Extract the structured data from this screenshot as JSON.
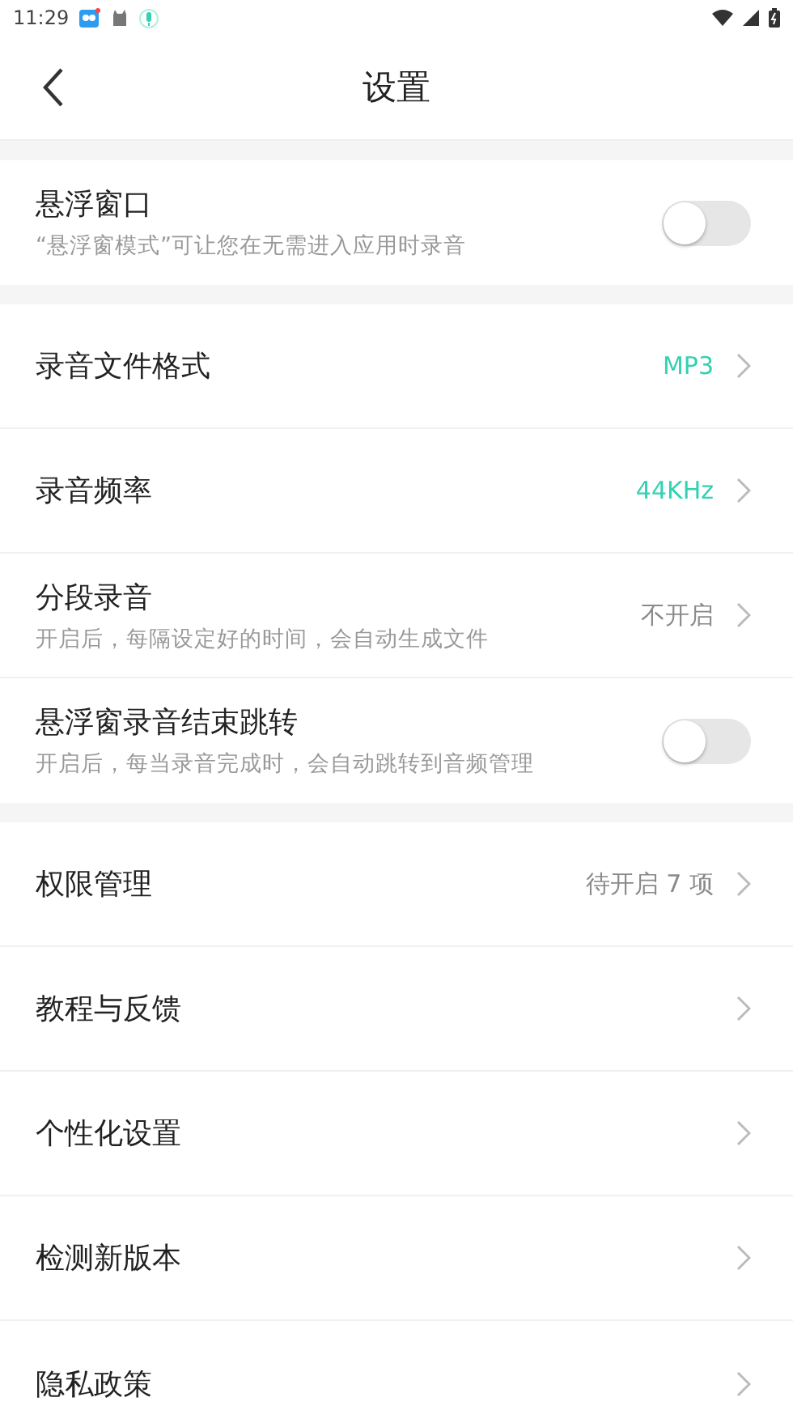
{
  "status_bar": {
    "time": "11:29"
  },
  "header": {
    "title": "设置"
  },
  "groups": [
    {
      "items": [
        {
          "kind": "toggle",
          "title": "悬浮窗口",
          "subtitle": "“悬浮窗模式”可让您在无需进入应用时录音",
          "on": false
        }
      ]
    },
    {
      "items": [
        {
          "kind": "link",
          "title": "录音文件格式",
          "value": "MP3",
          "color": "#33d1b3"
        },
        {
          "kind": "link",
          "title": "录音频率",
          "value": "44KHz",
          "color": "#33d1b3"
        },
        {
          "kind": "link",
          "title": "分段录音",
          "subtitle": "开启后，每隔设定好的时间，会自动生成文件",
          "value": "不开启",
          "color": "#8a8a8a"
        },
        {
          "kind": "toggle",
          "title": "悬浮窗录音结束跳转",
          "subtitle": "开启后，每当录音完成时，会自动跳转到音频管理",
          "on": false
        }
      ]
    },
    {
      "items": [
        {
          "kind": "link",
          "title": "权限管理",
          "value": "待开启 7 项",
          "color": "#8a8a8a"
        },
        {
          "kind": "link",
          "title": "教程与反馈"
        },
        {
          "kind": "link",
          "title": "个性化设置"
        },
        {
          "kind": "link",
          "title": "检测新版本"
        },
        {
          "kind": "link",
          "title": "隐私政策"
        }
      ]
    }
  ]
}
